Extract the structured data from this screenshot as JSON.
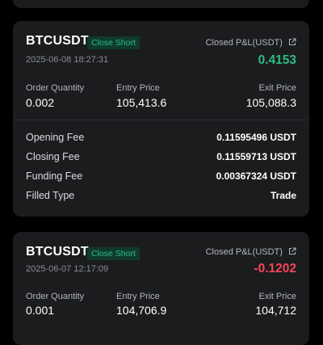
{
  "trades": [
    {
      "symbol": "BTCUSDT",
      "badge": "Close Short",
      "timestamp": "2025-06-08 18:27:31",
      "pnl_label": "Closed P&L(USDT)",
      "pnl_value": "0.4153",
      "order_quantity_label": "Order Quantity",
      "order_quantity": "0.002",
      "entry_price_label": "Entry Price",
      "entry_price": "105,413.6",
      "exit_price_label": "Exit Price",
      "exit_price": "105,088.3",
      "opening_fee_label": "Opening Fee",
      "opening_fee": "0.11595496 USDT",
      "closing_fee_label": "Closing Fee",
      "closing_fee": "0.11559713 USDT",
      "funding_fee_label": "Funding Fee",
      "funding_fee": "0.00367324 USDT",
      "filled_type_label": "Filled Type",
      "filled_type": "Trade"
    },
    {
      "symbol": "BTCUSDT",
      "badge": "Close Short",
      "timestamp": "2025-06-07 12:17:09",
      "pnl_label": "Closed P&L(USDT)",
      "pnl_value": "-0.1202",
      "order_quantity_label": "Order Quantity",
      "order_quantity": "0.001",
      "entry_price_label": "Entry Price",
      "entry_price": "104,706.9",
      "exit_price_label": "Exit Price",
      "exit_price": "104,712"
    }
  ],
  "colors": {
    "positive": "#2ebd85",
    "negative": "#f6465d",
    "card_bg": "#1b1c1e",
    "page_bg": "#000000"
  },
  "icons": {
    "pnl_link": "external-link-icon"
  }
}
